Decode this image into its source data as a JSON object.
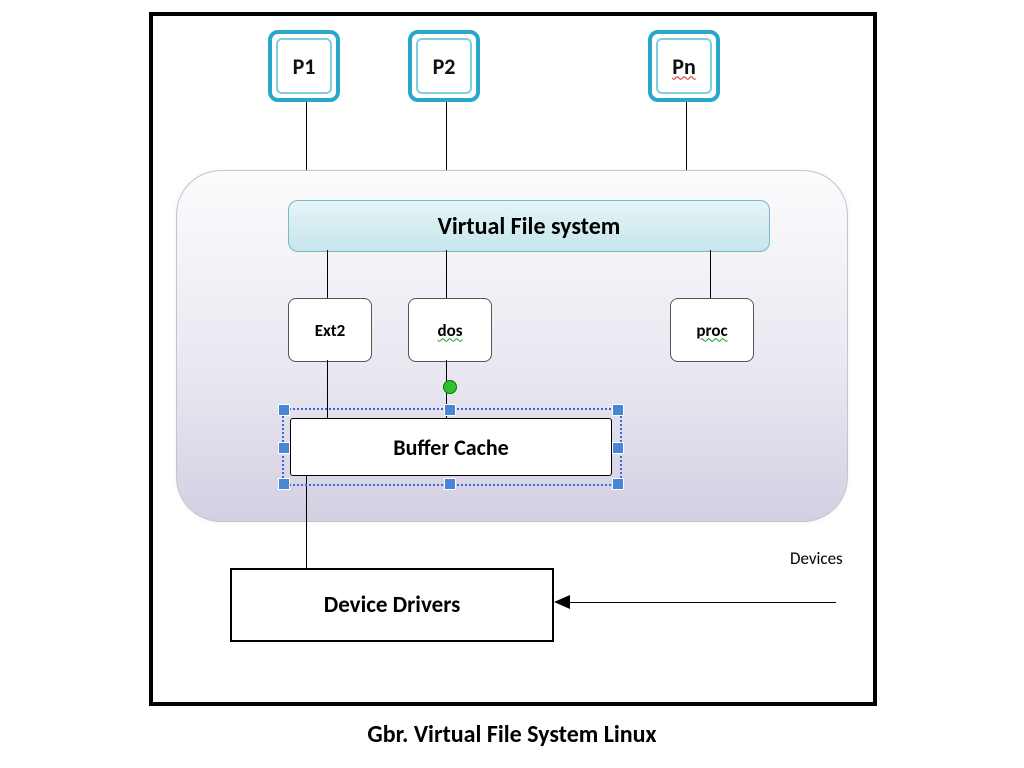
{
  "processes": {
    "p1": "P1",
    "p2": "P2",
    "pn": "Pn"
  },
  "vfs_label": "Virtual File system",
  "fs": {
    "ext2": "Ext2",
    "dos": "dos",
    "proc": "proc"
  },
  "buffer_cache": "Buffer Cache",
  "device_drivers": "Device Drivers",
  "devices_label": "Devices",
  "caption": "Gbr. Virtual File System Linux"
}
